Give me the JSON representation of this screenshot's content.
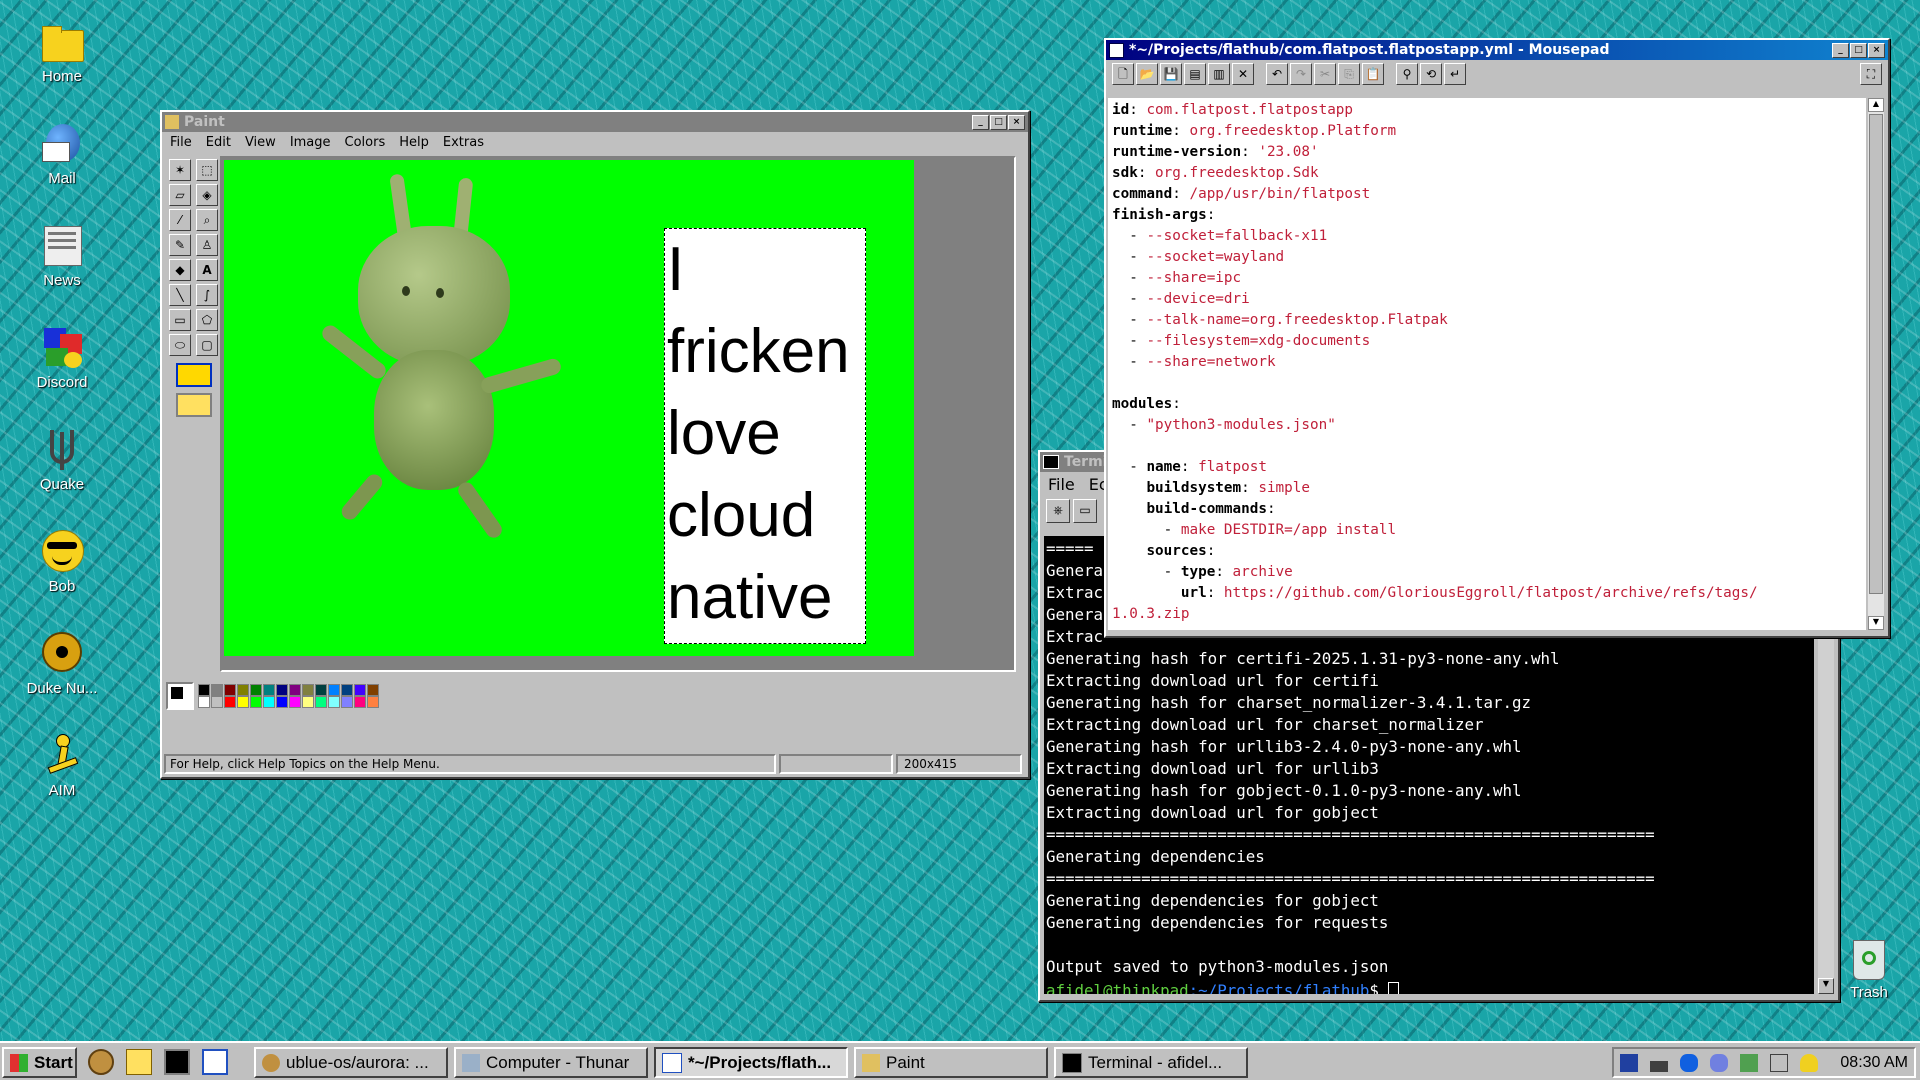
{
  "desktop": {
    "icons": [
      {
        "label": "Home",
        "icon": "folder-icon"
      },
      {
        "label": "Mail",
        "icon": "mail-icon"
      },
      {
        "label": "News",
        "icon": "news-icon"
      },
      {
        "label": "Discord",
        "icon": "discord-icon"
      },
      {
        "label": "Quake",
        "icon": "quake-icon"
      },
      {
        "label": "Bob",
        "icon": "bob-icon"
      },
      {
        "label": "Duke Nu...",
        "icon": "duke-nukem-icon"
      },
      {
        "label": "AIM",
        "icon": "aim-icon"
      }
    ],
    "trash_label": "Trash"
  },
  "paint": {
    "title": "Paint",
    "menu": [
      "File",
      "Edit",
      "View",
      "Image",
      "Colors",
      "Help",
      "Extras"
    ],
    "canvas_text": [
      "I",
      "fricken",
      "love",
      "cloud",
      "native"
    ],
    "canvas_bg": "#00ff00",
    "status_help": "For Help, click Help Topics on the Help Menu.",
    "status_size": "200x415",
    "palette": [
      "#000000",
      "#808080",
      "#800000",
      "#808000",
      "#008000",
      "#008080",
      "#000080",
      "#800080",
      "#808040",
      "#004040",
      "#0080ff",
      "#004080",
      "#4000ff",
      "#804000",
      "#ffffff",
      "#c0c0c0",
      "#ff0000",
      "#ffff00",
      "#00ff00",
      "#00ffff",
      "#0000ff",
      "#ff00ff",
      "#ffff80",
      "#00ff80",
      "#80ffff",
      "#8080ff",
      "#ff0080",
      "#ff8040"
    ]
  },
  "mousepad": {
    "title": "*~/Projects/flathub/com.flatpost.flatpostapp.yml - Mousepad",
    "lines": [
      [
        {
          "t": "id",
          "c": "k"
        },
        {
          "t": ": ",
          "c": ""
        },
        {
          "t": "com.flatpost.flatpostapp",
          "c": "v"
        }
      ],
      [
        {
          "t": "runtime",
          "c": "k"
        },
        {
          "t": ": ",
          "c": ""
        },
        {
          "t": "org.freedesktop.Platform",
          "c": "v"
        }
      ],
      [
        {
          "t": "runtime-version",
          "c": "k"
        },
        {
          "t": ": ",
          "c": ""
        },
        {
          "t": "'23.08'",
          "c": "v"
        }
      ],
      [
        {
          "t": "sdk",
          "c": "k"
        },
        {
          "t": ": ",
          "c": ""
        },
        {
          "t": "org.freedesktop.Sdk",
          "c": "v"
        }
      ],
      [
        {
          "t": "command",
          "c": "k"
        },
        {
          "t": ": ",
          "c": ""
        },
        {
          "t": "/app/usr/bin/flatpost",
          "c": "v"
        }
      ],
      [
        {
          "t": "finish-args",
          "c": "k"
        },
        {
          "t": ":",
          "c": ""
        }
      ],
      [
        {
          "t": "  - ",
          "c": ""
        },
        {
          "t": "--socket=fallback-x11",
          "c": "v"
        }
      ],
      [
        {
          "t": "  - ",
          "c": ""
        },
        {
          "t": "--socket=wayland",
          "c": "v"
        }
      ],
      [
        {
          "t": "  - ",
          "c": ""
        },
        {
          "t": "--share=ipc",
          "c": "v"
        }
      ],
      [
        {
          "t": "  - ",
          "c": ""
        },
        {
          "t": "--device=dri",
          "c": "v"
        }
      ],
      [
        {
          "t": "  - ",
          "c": ""
        },
        {
          "t": "--talk-name=org.freedesktop.Flatpak",
          "c": "v"
        }
      ],
      [
        {
          "t": "  - ",
          "c": ""
        },
        {
          "t": "--filesystem=xdg-documents",
          "c": "v"
        }
      ],
      [
        {
          "t": "  - ",
          "c": ""
        },
        {
          "t": "--share=network",
          "c": "v"
        }
      ],
      [
        {
          "t": "",
          "c": ""
        }
      ],
      [
        {
          "t": "modules",
          "c": "k"
        },
        {
          "t": ":",
          "c": ""
        }
      ],
      [
        {
          "t": "  - ",
          "c": ""
        },
        {
          "t": "\"python3-modules.json\"",
          "c": "v"
        }
      ],
      [
        {
          "t": "",
          "c": ""
        }
      ],
      [
        {
          "t": "  - ",
          "c": ""
        },
        {
          "t": "name",
          "c": "k"
        },
        {
          "t": ": ",
          "c": ""
        },
        {
          "t": "flatpost",
          "c": "v"
        }
      ],
      [
        {
          "t": "    ",
          "c": ""
        },
        {
          "t": "buildsystem",
          "c": "k"
        },
        {
          "t": ": ",
          "c": ""
        },
        {
          "t": "simple",
          "c": "v"
        }
      ],
      [
        {
          "t": "    ",
          "c": ""
        },
        {
          "t": "build-commands",
          "c": "k"
        },
        {
          "t": ":",
          "c": ""
        }
      ],
      [
        {
          "t": "      - ",
          "c": ""
        },
        {
          "t": "make DESTDIR=/app install",
          "c": "v"
        }
      ],
      [
        {
          "t": "    ",
          "c": ""
        },
        {
          "t": "sources",
          "c": "k"
        },
        {
          "t": ":",
          "c": ""
        }
      ],
      [
        {
          "t": "      - ",
          "c": ""
        },
        {
          "t": "type",
          "c": "k"
        },
        {
          "t": ": ",
          "c": ""
        },
        {
          "t": "archive",
          "c": "v"
        }
      ],
      [
        {
          "t": "        ",
          "c": ""
        },
        {
          "t": "url",
          "c": "k"
        },
        {
          "t": ": ",
          "c": ""
        },
        {
          "t": "https://github.com/GloriousEggroll/flatpost/archive/refs/tags/",
          "c": "v"
        }
      ],
      [
        {
          "t": "1.0.3.zip",
          "c": "v"
        }
      ]
    ]
  },
  "terminal": {
    "title": "Terminal",
    "menu": [
      "File",
      "Ec"
    ],
    "partial_lines": [
      "=====",
      "Genera",
      "Extrac",
      "Genera",
      "Extrac"
    ],
    "lines": [
      "Generating hash for certifi-2025.1.31-py3-none-any.whl",
      "Extracting download url for certifi",
      "Generating hash for charset_normalizer-3.4.1.tar.gz",
      "Extracting download url for charset_normalizer",
      "Generating hash for urllib3-2.4.0-py3-none-any.whl",
      "Extracting download url for urllib3",
      "Generating hash for gobject-0.1.0-py3-none-any.whl",
      "Extracting download url for gobject",
      "================================================================",
      "Generating dependencies",
      "================================================================",
      "Generating dependencies for gobject",
      "Generating dependencies for requests",
      "",
      "Output saved to python3-modules.json"
    ],
    "prompt_user": "afidel@thinkpad",
    "prompt_path": ":~/Projects/flathub",
    "prompt_symbol": "$"
  },
  "taskbar": {
    "start_label": "Start",
    "buttons": [
      {
        "label": "ublue-os/aurora: ...",
        "icon": "browser-icon"
      },
      {
        "label": "Computer - Thunar",
        "icon": "file-manager-icon"
      },
      {
        "label": "*~/Projects/flath...",
        "icon": "text-editor-icon",
        "pressed": true
      },
      {
        "label": "Paint",
        "icon": "paint-icon"
      },
      {
        "label": "Terminal - afidel...",
        "icon": "terminal-icon"
      }
    ],
    "clock": "08:30 AM"
  }
}
